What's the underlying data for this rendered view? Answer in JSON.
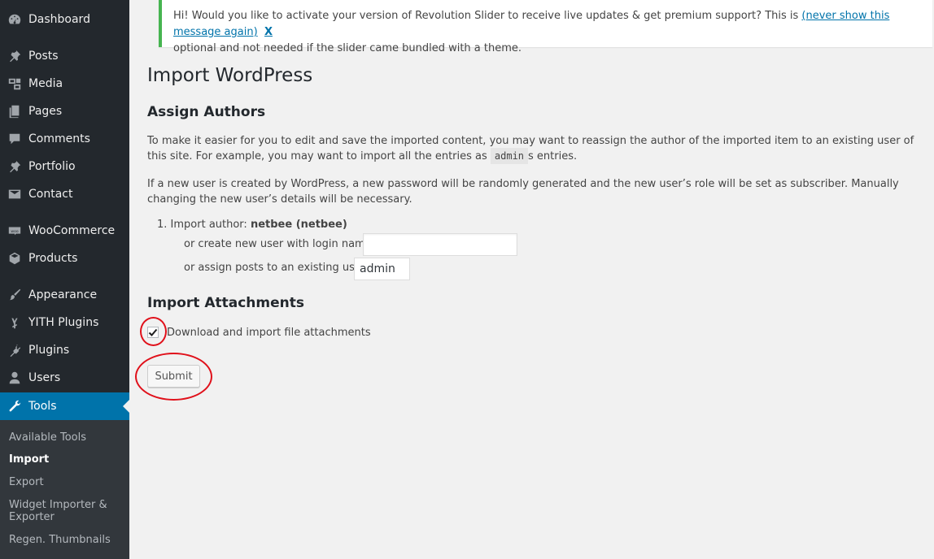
{
  "sidebar": {
    "items": [
      {
        "label": "Dashboard",
        "icon": "dashboard-icon"
      },
      {
        "label": "Posts",
        "icon": "pin-icon"
      },
      {
        "label": "Media",
        "icon": "media-icon"
      },
      {
        "label": "Pages",
        "icon": "pages-icon"
      },
      {
        "label": "Comments",
        "icon": "comment-icon"
      },
      {
        "label": "Portfolio",
        "icon": "pin-icon"
      },
      {
        "label": "Contact",
        "icon": "mail-icon"
      },
      {
        "label": "WooCommerce",
        "icon": "woo-icon"
      },
      {
        "label": "Products",
        "icon": "box-icon"
      },
      {
        "label": "Appearance",
        "icon": "brush-icon"
      },
      {
        "label": "YITH Plugins",
        "icon": "yith-icon"
      },
      {
        "label": "Plugins",
        "icon": "plug-icon"
      },
      {
        "label": "Users",
        "icon": "user-icon"
      },
      {
        "label": "Tools",
        "icon": "wrench-icon"
      }
    ],
    "submenu": [
      "Available Tools",
      "Import",
      "Export",
      "Widget Importer & Exporter",
      "Regen. Thumbnails"
    ]
  },
  "notice": {
    "text_before": "Hi! Would you like to activate your version of Revolution Slider to receive live updates & get premium support? This is ",
    "link": "(never show this message again)",
    "close": "X",
    "text_after": "optional and not needed if the slider came bundled with a theme."
  },
  "page": {
    "title": "Import WordPress",
    "assign_heading": "Assign Authors",
    "para1_before": "To make it easier for you to edit and save the imported content, you may want to reassign the author of the imported item to an existing user of this site. For example, you may want to import all the entries as ",
    "para1_code": "admin",
    "para1_after": "s entries.",
    "para2": "If a new user is created by WordPress, a new password will be randomly generated and the new user’s role will be set as subscriber. Manually changing the new user’s details will be necessary.",
    "author_prefix": "1. Import author: ",
    "author_name": "netbee (netbee)",
    "new_user_label": "or create new user with login name:",
    "new_user_value": "",
    "assign_label": "or assign posts to an existing user:",
    "assign_value": "admin",
    "attachments_heading": "Import Attachments",
    "attachments_label": "Download and import file attachments",
    "attachments_checked": true,
    "submit_label": "Submit"
  },
  "colors": {
    "sidebar_bg": "#23282d",
    "active_bg": "#0073aa",
    "notice_border": "#46b450",
    "annotation": "#e0101a"
  }
}
